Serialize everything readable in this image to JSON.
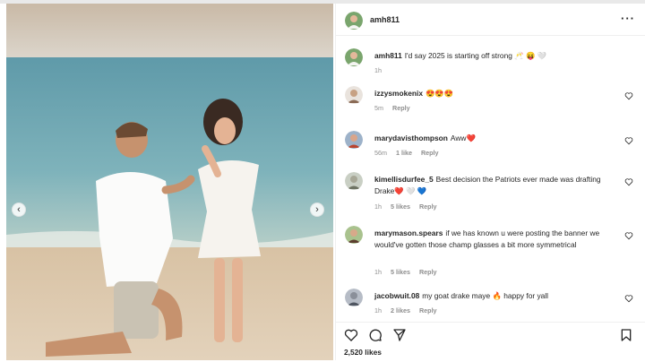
{
  "post": {
    "username": "amh811",
    "likes_text": "2,520 likes"
  },
  "caption": {
    "username": "amh811",
    "text": "I'd say 2025 is starting off strong 🥂 😝 🤍",
    "time": "1h"
  },
  "comments": [
    {
      "username": "izzysmokenix",
      "text": "😍😍😍",
      "time": "5m",
      "likes": "",
      "reply": "Reply"
    },
    {
      "username": "marydavisthompson",
      "text": "Aww❤️",
      "time": "56m",
      "likes": "1 like",
      "reply": "Reply"
    },
    {
      "username": "kimellisdurfee_5",
      "text": "Best decision the Patriots ever made was drafting Drake❤️ 🤍 💙",
      "time": "1h",
      "likes": "5 likes",
      "reply": "Reply"
    },
    {
      "username": "marymason.spears",
      "text": "if we has known u were posting the banner we would've gotten those champ glasses a bit more symmetrical",
      "time": "1h",
      "likes": "5 likes",
      "reply": "Reply"
    },
    {
      "username": "jacobwuit.08",
      "text": "my goat drake maye 🔥 happy for yall",
      "time": "1h",
      "likes": "2 likes",
      "reply": "Reply"
    }
  ],
  "icons": {
    "more": "more-options-icon",
    "like": "heart-icon",
    "comment": "comment-icon",
    "share": "share-icon",
    "save": "bookmark-icon",
    "prev": "chevron-left-icon",
    "next": "chevron-right-icon"
  },
  "nav": {
    "prev_glyph": "‹",
    "next_glyph": "›",
    "more_glyph": "···"
  }
}
